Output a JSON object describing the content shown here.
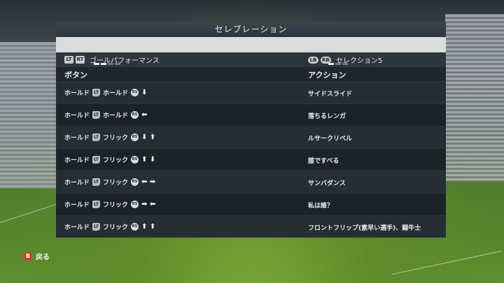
{
  "title": "セレブレーション",
  "tabs": {
    "left": {
      "btn1": "LT",
      "btn2": "RT",
      "label": "ゴールパフォーマンス"
    },
    "right": {
      "btn1": "LB",
      "btn2": "RB",
      "label": "セレクション5"
    }
  },
  "headers": {
    "button": "ボタン",
    "action": "アクション"
  },
  "rows": [
    {
      "hold": "ホールド",
      "trigger": "LT",
      "verb": "ホールド",
      "stick": "RS",
      "arrows": "⬇",
      "action": "サイドスライド"
    },
    {
      "hold": "ホールド",
      "trigger": "LT",
      "verb": "ホールド",
      "stick": "RS",
      "arrows": "⬅",
      "action": "落ちるレンガ"
    },
    {
      "hold": "ホールド",
      "trigger": "LT",
      "verb": "フリック",
      "stick": "RS",
      "arrows": "⬇ ⬆",
      "action": "ルサークリベル"
    },
    {
      "hold": "ホールド",
      "trigger": "LT",
      "verb": "フリック",
      "stick": "RS",
      "arrows": "⬆ ⬇",
      "action": "膝ですべる"
    },
    {
      "hold": "ホールド",
      "trigger": "LT",
      "verb": "フリック",
      "stick": "RS",
      "arrows": "⬅ ➡",
      "action": "サンバダンス"
    },
    {
      "hold": "ホールド",
      "trigger": "LT",
      "verb": "フリック",
      "stick": "RS",
      "arrows": "➡ ⬅",
      "action": "私は誰？"
    },
    {
      "hold": "ホールド",
      "trigger": "LT",
      "verb": "フリック",
      "stick": "RS",
      "arrows": "⬆ ⬆",
      "action": "フロントフリップ(素早い選手)、闘牛士"
    }
  ],
  "footer": {
    "button": "B",
    "label": "戻る"
  }
}
